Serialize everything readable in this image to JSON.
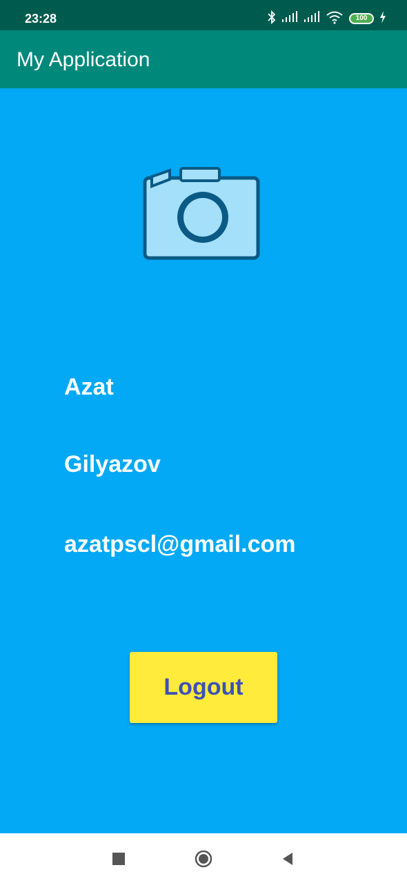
{
  "status_bar": {
    "time": "23:28",
    "battery_level": "100",
    "icons": [
      "bluetooth-icon",
      "signal-icon",
      "signal-icon",
      "wifi-icon",
      "battery-icon",
      "charging-icon"
    ]
  },
  "app_bar": {
    "title": "My Application"
  },
  "profile": {
    "avatar_icon": "camera-icon",
    "first_name": "Azat",
    "last_name": "Gilyazov",
    "email": "azatpscl@gmail.com"
  },
  "actions": {
    "logout_label": "Logout"
  },
  "nav_bar": {
    "buttons": [
      "recents-icon",
      "home-icon",
      "back-icon"
    ]
  },
  "colors": {
    "status_bar": "#005b4f",
    "app_bar": "#00897b",
    "background": "#03a9f4",
    "logout_button": "#ffeb3b",
    "logout_text": "#3f51b5",
    "text": "#ffffff",
    "nav_bar": "#ffffff"
  }
}
